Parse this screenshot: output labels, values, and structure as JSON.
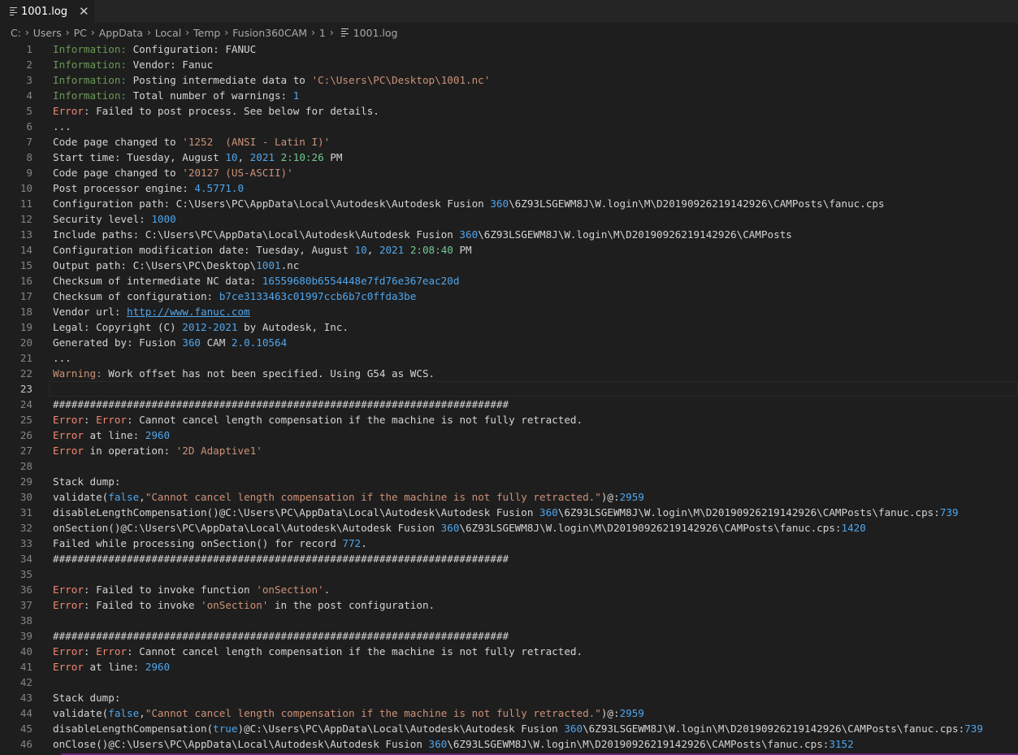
{
  "tab": {
    "title": "1001.log",
    "close": "✕"
  },
  "breadcrumb": [
    "C:",
    "Users",
    "PC",
    "AppData",
    "Local",
    "Temp",
    "Fusion360CAM",
    "1",
    "1001.log"
  ],
  "breadcrumb_sep": "›",
  "current_line": 23,
  "lines": [
    [
      [
        "Information:",
        "info"
      ],
      [
        " Configuration: FANUC",
        ""
      ]
    ],
    [
      [
        "Information:",
        "info"
      ],
      [
        " Vendor: Fanuc",
        ""
      ]
    ],
    [
      [
        "Information:",
        "info"
      ],
      [
        " Posting intermediate data to ",
        ""
      ],
      [
        "'C:\\Users\\PC\\Desktop\\1001.nc'",
        "str"
      ]
    ],
    [
      [
        "Information:",
        "info"
      ],
      [
        " Total number of warnings: ",
        ""
      ],
      [
        "1",
        "num"
      ]
    ],
    [
      [
        "Error",
        "err"
      ],
      [
        ": Failed to post process. See below for details.",
        ""
      ]
    ],
    [
      [
        "...",
        ""
      ]
    ],
    [
      [
        "Code page changed to ",
        ""
      ],
      [
        "'1252  (ANSI - Latin I)'",
        "str"
      ]
    ],
    [
      [
        "Start time: Tuesday, August ",
        ""
      ],
      [
        "10",
        "num"
      ],
      [
        ", ",
        ""
      ],
      [
        "2021",
        "num"
      ],
      [
        " ",
        ""
      ],
      [
        "2:10:26",
        "time"
      ],
      [
        " PM",
        ""
      ]
    ],
    [
      [
        "Code page changed to ",
        ""
      ],
      [
        "'20127 (US-ASCII)'",
        "str"
      ]
    ],
    [
      [
        "Post processor engine: ",
        ""
      ],
      [
        "4.5771.0",
        "num"
      ]
    ],
    [
      [
        "Configuration path: C:\\Users\\PC\\AppData\\Local\\Autodesk\\Autodesk Fusion ",
        ""
      ],
      [
        "360",
        "num"
      ],
      [
        "\\6Z93LSGEWM8J\\W.login\\M\\D20190926219142926\\CAMPosts\\fanuc.cps",
        ""
      ]
    ],
    [
      [
        "Security level: ",
        ""
      ],
      [
        "1000",
        "num"
      ]
    ],
    [
      [
        "Include paths: C:\\Users\\PC\\AppData\\Local\\Autodesk\\Autodesk Fusion ",
        ""
      ],
      [
        "360",
        "num"
      ],
      [
        "\\6Z93LSGEWM8J\\W.login\\M\\D20190926219142926\\CAMPosts",
        ""
      ]
    ],
    [
      [
        "Configuration modification date: Tuesday, August ",
        ""
      ],
      [
        "10",
        "num"
      ],
      [
        ", ",
        ""
      ],
      [
        "2021",
        "num"
      ],
      [
        " ",
        ""
      ],
      [
        "2:08:40",
        "time"
      ],
      [
        " PM",
        ""
      ]
    ],
    [
      [
        "Output path: C:\\Users\\PC\\Desktop\\",
        ""
      ],
      [
        "1001",
        "num"
      ],
      [
        ".nc",
        ""
      ]
    ],
    [
      [
        "Checksum of intermediate NC data: ",
        ""
      ],
      [
        "16559680b6554448e7fd76e367eac20d",
        "num"
      ]
    ],
    [
      [
        "Checksum of configuration: ",
        ""
      ],
      [
        "b7ce3133463c01997ccb6b7c0ffda3be",
        "num"
      ]
    ],
    [
      [
        "Vendor url: ",
        ""
      ],
      [
        "http://www.fanuc.com",
        "link"
      ]
    ],
    [
      [
        "Legal: Copyright (C) ",
        ""
      ],
      [
        "2012-2021",
        "num"
      ],
      [
        " by Autodesk, Inc.",
        ""
      ]
    ],
    [
      [
        "Generated by: Fusion ",
        ""
      ],
      [
        "360",
        "num"
      ],
      [
        " CAM ",
        ""
      ],
      [
        "2.0.10564",
        "num"
      ]
    ],
    [
      [
        "...",
        ""
      ]
    ],
    [
      [
        "Warning:",
        "warn"
      ],
      [
        " Work offset has not been specified. Using G54 as WCS.",
        ""
      ]
    ],
    [],
    [
      [
        "##########################################################################",
        ""
      ]
    ],
    [
      [
        "Error",
        "err"
      ],
      [
        ": ",
        ""
      ],
      [
        "Error",
        "err"
      ],
      [
        ": Cannot cancel length compensation if the machine is not fully retracted.",
        ""
      ]
    ],
    [
      [
        "Error",
        "err"
      ],
      [
        " at line: ",
        ""
      ],
      [
        "2960",
        "num"
      ]
    ],
    [
      [
        "Error",
        "err"
      ],
      [
        " in operation: ",
        ""
      ],
      [
        "'2D Adaptive1'",
        "str"
      ]
    ],
    [],
    [
      [
        "Stack dump:",
        ""
      ]
    ],
    [
      [
        "validate(",
        ""
      ],
      [
        "false",
        "num"
      ],
      [
        ",",
        ""
      ],
      [
        "\"Cannot cancel length compensation if the machine is not fully retracted.\"",
        "str"
      ],
      [
        ")@:",
        ""
      ],
      [
        "2959",
        "num"
      ]
    ],
    [
      [
        "disableLengthCompensation()@C:\\Users\\PC\\AppData\\Local\\Autodesk\\Autodesk Fusion ",
        ""
      ],
      [
        "360",
        "num"
      ],
      [
        "\\6Z93LSGEWM8J\\W.login\\M\\D20190926219142926\\CAMPosts\\fanuc.cps:",
        ""
      ],
      [
        "739",
        "num"
      ]
    ],
    [
      [
        "onSection()@C:\\Users\\PC\\AppData\\Local\\Autodesk\\Autodesk Fusion ",
        ""
      ],
      [
        "360",
        "num"
      ],
      [
        "\\6Z93LSGEWM8J\\W.login\\M\\D20190926219142926\\CAMPosts\\fanuc.cps:",
        ""
      ],
      [
        "1420",
        "num"
      ]
    ],
    [
      [
        "Failed while processing onSection() for record ",
        ""
      ],
      [
        "772",
        "num"
      ],
      [
        ".",
        ""
      ]
    ],
    [
      [
        "##########################################################################",
        ""
      ]
    ],
    [],
    [
      [
        "Error",
        "err"
      ],
      [
        ": Failed to invoke function ",
        ""
      ],
      [
        "'onSection'",
        "str"
      ],
      [
        ".",
        ""
      ]
    ],
    [
      [
        "Error",
        "err"
      ],
      [
        ": Failed to invoke ",
        ""
      ],
      [
        "'onSection'",
        "str"
      ],
      [
        " in the post configuration.",
        ""
      ]
    ],
    [],
    [
      [
        "##########################################################################",
        ""
      ]
    ],
    [
      [
        "Error",
        "err"
      ],
      [
        ": ",
        ""
      ],
      [
        "Error",
        "err"
      ],
      [
        ": Cannot cancel length compensation if the machine is not fully retracted.",
        ""
      ]
    ],
    [
      [
        "Error",
        "err"
      ],
      [
        " at line: ",
        ""
      ],
      [
        "2960",
        "num"
      ]
    ],
    [],
    [
      [
        "Stack dump:",
        ""
      ]
    ],
    [
      [
        "validate(",
        ""
      ],
      [
        "false",
        "num"
      ],
      [
        ",",
        ""
      ],
      [
        "\"Cannot cancel length compensation if the machine is not fully retracted.\"",
        "str"
      ],
      [
        ")@:",
        ""
      ],
      [
        "2959",
        "num"
      ]
    ],
    [
      [
        "disableLengthCompensation(",
        ""
      ],
      [
        "true",
        "num"
      ],
      [
        ")@C:\\Users\\PC\\AppData\\Local\\Autodesk\\Autodesk Fusion ",
        ""
      ],
      [
        "360",
        "num"
      ],
      [
        "\\6Z93LSGEWM8J\\W.login\\M\\D20190926219142926\\CAMPosts\\fanuc.cps:",
        ""
      ],
      [
        "739",
        "num"
      ]
    ],
    [
      [
        "onClose()@C:\\Users\\PC\\AppData\\Local\\Autodesk\\Autodesk Fusion ",
        ""
      ],
      [
        "360",
        "num"
      ],
      [
        "\\6Z93LSGEWM8J\\W.login\\M\\D20190926219142926\\CAMPosts\\fanuc.cps:",
        ""
      ],
      [
        "3152",
        "num"
      ]
    ]
  ]
}
